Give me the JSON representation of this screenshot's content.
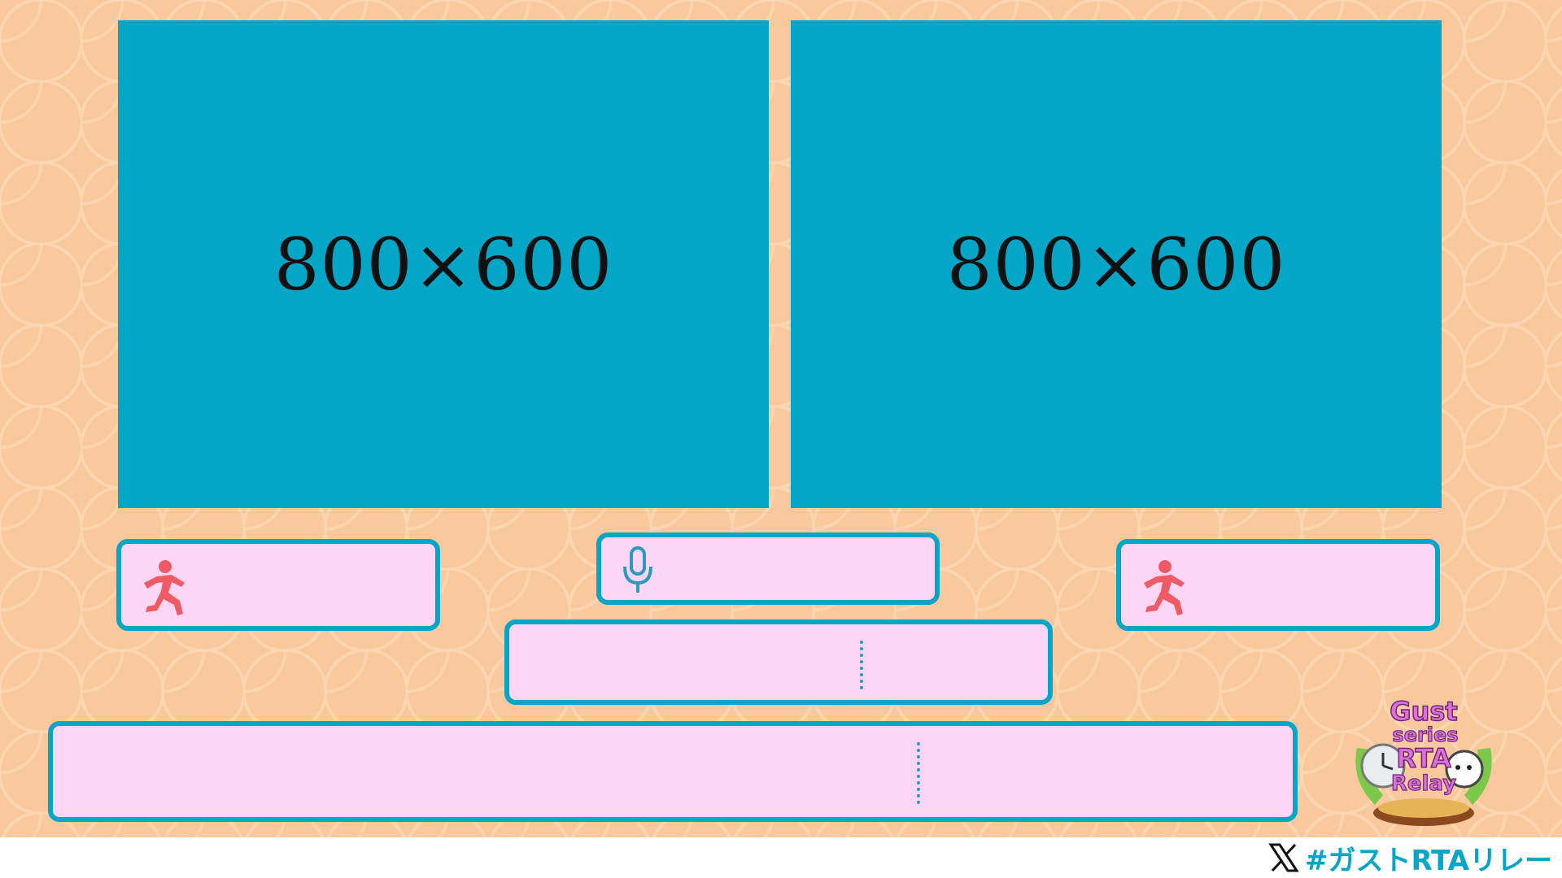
{
  "screens": {
    "left": {
      "label": "800×600"
    },
    "right": {
      "label": "800×600"
    }
  },
  "footer": {
    "hashtag": "#ガストRTAリレー",
    "social_icon": "x-logo-icon"
  },
  "logo": {
    "line1": "Gust",
    "line2": "series",
    "line3": "RTA",
    "line4": "Relay"
  },
  "icons": {
    "runner": "running-person-icon",
    "mic": "microphone-icon"
  },
  "colors": {
    "background": "#f9c89d",
    "screen": "#03a6c6",
    "box_fill": "#fdd6f5",
    "box_border": "#03a6c6",
    "runner_icon": "#ef5a64",
    "hashtag": "#03a6c6"
  }
}
